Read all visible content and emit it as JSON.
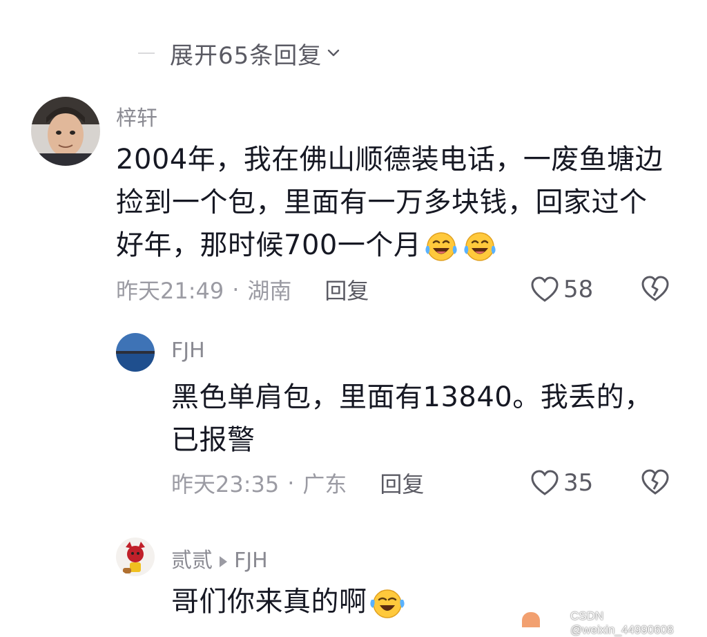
{
  "expand": {
    "label": "展开65条回复"
  },
  "comments": [
    {
      "username": "梓轩",
      "content_lines": [
        "2004年，我在佛山顺德装电话，一废鱼塘边",
        "捡到一个包，里面有一万多块钱，回家过个",
        "好年，那时候700一个月"
      ],
      "emojis": [
        "laughing-tears-emoji",
        "laughing-tears-emoji"
      ],
      "time": "昨天21:49",
      "location": "湖南",
      "reply_label": "回复",
      "likes": "58"
    },
    {
      "username": "FJH",
      "content_lines": [
        "黑色单肩包，里面有13840。我丢的，",
        "已报警"
      ],
      "time": "昨天23:35",
      "location": "广东",
      "reply_label": "回复",
      "likes": "35"
    },
    {
      "username": "贰贰",
      "reply_to": "FJH",
      "content_lines": [
        "哥们你来真的啊"
      ],
      "emojis": [
        "tears-of-joy-emoji"
      ]
    }
  ],
  "watermark": "CSDN @weixin_44990608",
  "colors": {
    "text": "#161823",
    "meta": "#9b9ba3",
    "emoji": "#ffc93c"
  }
}
